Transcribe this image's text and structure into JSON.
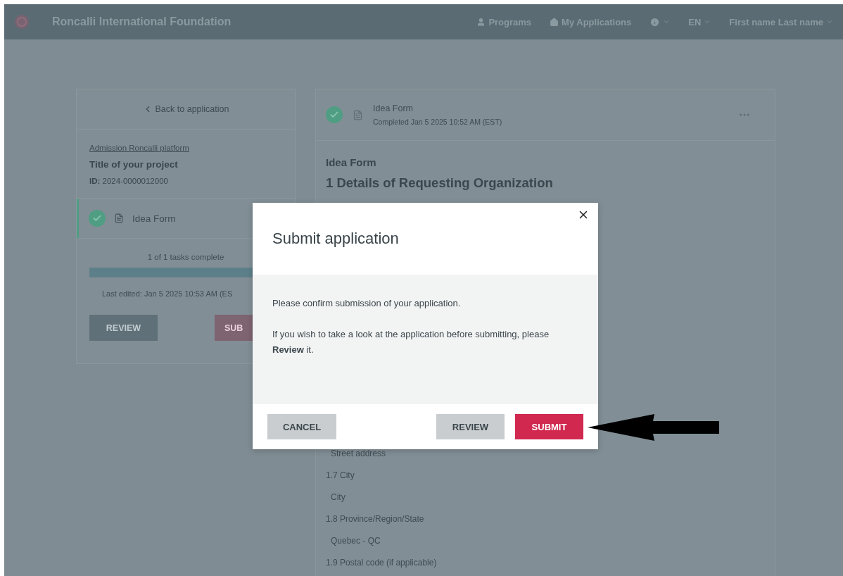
{
  "header": {
    "brand": "Roncalli International Foundation",
    "nav": [
      {
        "kind": "link",
        "label": "Programs"
      },
      {
        "kind": "link",
        "label": "My Applications"
      },
      {
        "kind": "icon-menu"
      },
      {
        "kind": "menu",
        "label": "EN"
      },
      {
        "kind": "menu",
        "label": "First name Last name"
      }
    ]
  },
  "sidebar": {
    "back_link": "Back to application",
    "program_link": "Admission Roncalli platform",
    "project_title": "Title of your project",
    "id_label": "ID:",
    "id_value": "2024-0000012000",
    "tasks": [
      {
        "label": "Idea Form",
        "completed": true,
        "selected": true
      }
    ],
    "progress": {
      "text": "1 of 1 tasks complete",
      "level": 1
    },
    "last_edited": "Last edited: Jan 5 2025 10:53 AM (ES",
    "buttons": [
      {
        "label": "REVIEW",
        "kind": "secondary"
      },
      {
        "label": "SUB",
        "kind": "primary"
      }
    ]
  },
  "form": {
    "header": {
      "title": "Idea Form",
      "status": "Completed Jan 5 2025 10:52 AM (EST)",
      "completed": true
    },
    "form_title": "Idea Form",
    "section_title": "1 Details of Requesting Organization",
    "fields": [
      {
        "kind": "value",
        "text": "Street address"
      },
      {
        "kind": "label",
        "text": "1.7 City"
      },
      {
        "kind": "value",
        "text": "City"
      },
      {
        "kind": "label",
        "text": "1.8 Province/Region/State"
      },
      {
        "kind": "value",
        "text": "Quebec - QC"
      },
      {
        "kind": "label",
        "text": "1.9 Postal code (if applicable)"
      }
    ]
  },
  "modal": {
    "title": "Submit application",
    "paragraphs": [
      "Please confirm submission of your application.",
      "If you wish to take a look at the application before submitting, please **Review** it."
    ],
    "buttons": [
      {
        "label": "CANCEL",
        "kind": "secondary"
      },
      {
        "label": "REVIEW",
        "kind": "secondary"
      },
      {
        "label": "SUBMIT",
        "kind": "primary"
      }
    ]
  }
}
